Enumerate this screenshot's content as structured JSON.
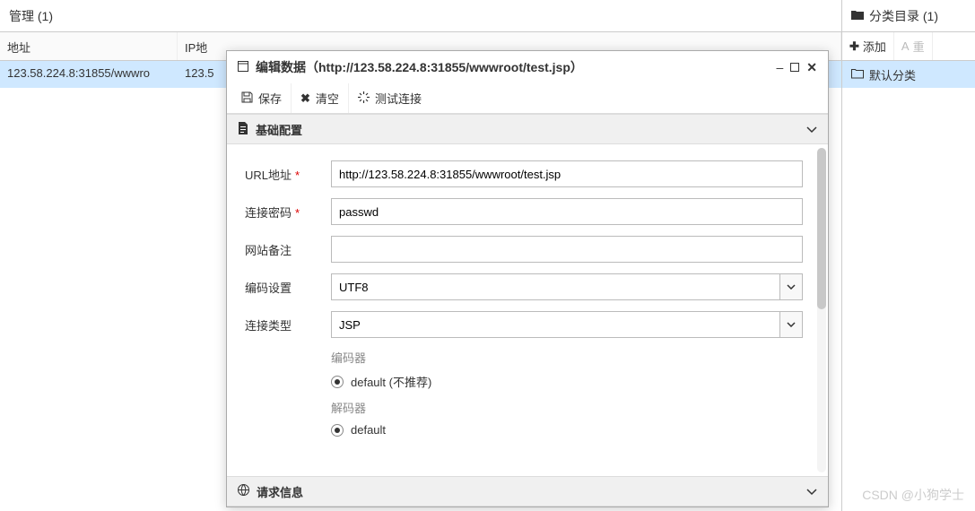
{
  "main": {
    "title": "管理 (1)",
    "columns": {
      "url": "地址",
      "ip": "IP地"
    },
    "rows": [
      {
        "url": "123.58.224.8:31855/wwwro",
        "ip": "123.5"
      }
    ]
  },
  "right": {
    "title": "分类目录 (1)",
    "add_label": "添加",
    "rename_label": "重",
    "tree": [
      {
        "label": "默认分类"
      }
    ]
  },
  "dialog": {
    "title": "编辑数据（http://123.58.224.8:31855/wwwroot/test.jsp）",
    "toolbar": {
      "save": "保存",
      "clear": "清空",
      "test": "测试连接"
    },
    "sections": {
      "basic": "基础配置",
      "request": "请求信息"
    },
    "form": {
      "url_label": "URL地址",
      "url_value": "http://123.58.224.8:31855/wwwroot/test.jsp",
      "password_label": "连接密码",
      "password_value": "passwd",
      "note_label": "网站备注",
      "note_value": "",
      "encoding_label": "编码设置",
      "encoding_value": "UTF8",
      "type_label": "连接类型",
      "type_value": "JSP",
      "encoder_label": "编码器",
      "encoder_option": "default (不推荐)",
      "decoder_label": "解码器",
      "decoder_option": "default"
    }
  },
  "watermark": "CSDN @小狗学士"
}
